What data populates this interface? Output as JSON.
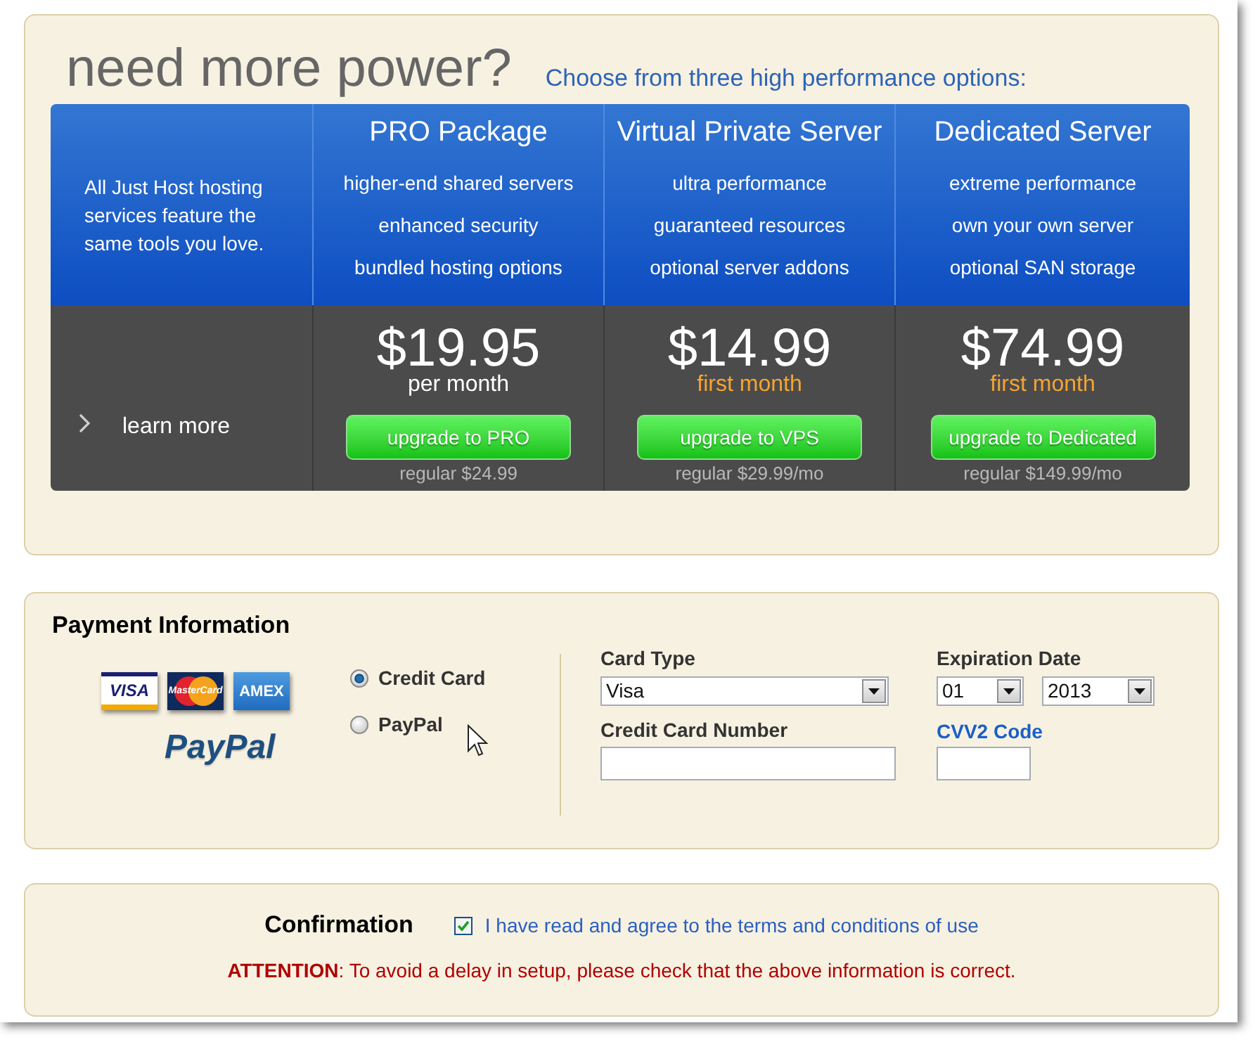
{
  "header": {
    "title": "need more power?",
    "subtitle": "Choose from three high performance options:"
  },
  "intro": {
    "text": "All Just Host hosting services feature the same tools you love.",
    "link": "learn more"
  },
  "plans": [
    {
      "name": "PRO Package",
      "features": [
        "higher-end shared servers",
        "enhanced security",
        "bundled hosting options"
      ],
      "price": "$19.95",
      "period": "per month",
      "promo": false,
      "button": "upgrade to PRO",
      "regular": "regular $24.99"
    },
    {
      "name": "Virtual Private Server",
      "features": [
        "ultra performance",
        "guaranteed resources",
        "optional server addons"
      ],
      "price": "$14.99",
      "period": "first month",
      "promo": true,
      "button": "upgrade to VPS",
      "regular": "regular $29.99/mo"
    },
    {
      "name": "Dedicated Server",
      "features": [
        "extreme performance",
        "own your own server",
        "optional SAN storage"
      ],
      "price": "$74.99",
      "period": "first month",
      "promo": true,
      "button": "upgrade to Dedicated",
      "regular": "regular $149.99/mo"
    }
  ],
  "payment": {
    "title": "Payment Information",
    "card_logos": [
      {
        "kind": "visa",
        "text": "VISA"
      },
      {
        "kind": "mastercard",
        "text": "MasterCard"
      },
      {
        "kind": "amex",
        "text": "AMEX"
      }
    ],
    "paypal_logo": "PayPal",
    "methods": [
      {
        "label": "Credit Card",
        "selected": true
      },
      {
        "label": "PayPal",
        "selected": false
      }
    ],
    "card_type": {
      "label": "Card Type",
      "value": "Visa"
    },
    "expiration": {
      "label": "Expiration Date",
      "month": "01",
      "year": "2013"
    },
    "card_number": {
      "label": "Credit Card Number"
    },
    "cvv": {
      "label": "CVV2 Code"
    }
  },
  "confirmation": {
    "title": "Confirmation",
    "agree": {
      "label": "I have read and agree to the terms and conditions of use",
      "checked": true
    },
    "notice": "**ATTENTION**: To avoid a delay in setup, please check that the above information is correct."
  }
}
